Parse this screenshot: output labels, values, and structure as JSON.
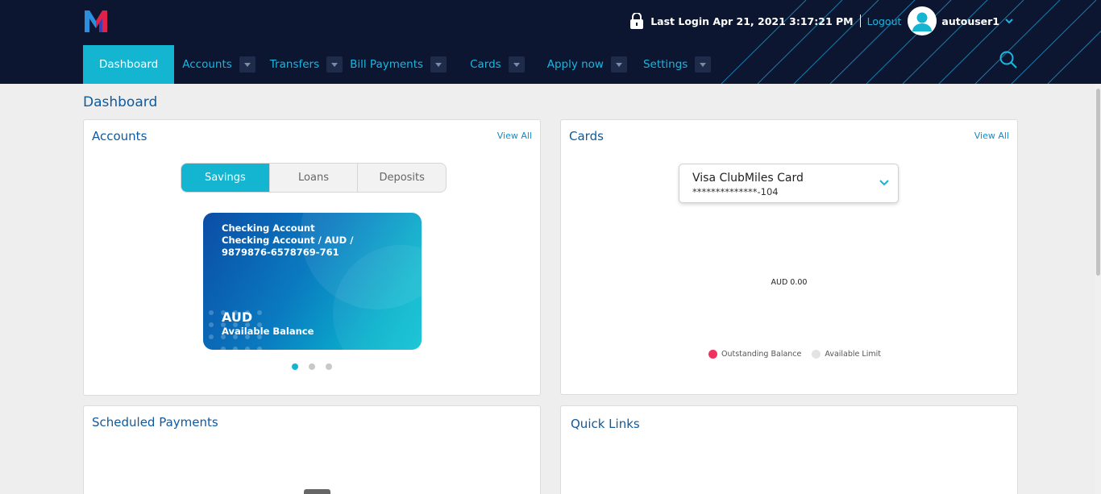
{
  "header": {
    "last_login": "Last Login Apr 21, 2021 3:17:21 PM",
    "logout": "Logout",
    "username": "autouser1"
  },
  "nav": [
    {
      "label": "Dashboard",
      "active": true
    },
    {
      "label": "Accounts"
    },
    {
      "label": "Transfers"
    },
    {
      "label": "Bill Payments"
    },
    {
      "label": "Cards"
    },
    {
      "label": "Apply now"
    },
    {
      "label": "Settings"
    }
  ],
  "page": {
    "title": "Dashboard"
  },
  "accounts": {
    "title": "Accounts",
    "view_all": "View All",
    "tabs": [
      "Savings",
      "Loans",
      "Deposits"
    ],
    "card": {
      "name": "Checking Account",
      "detail": "Checking Account / AUD / 9879876-6578769-761",
      "currency": "AUD",
      "balance_label": "Available Balance"
    }
  },
  "cards": {
    "title": "Cards",
    "view_all": "View All",
    "selected_card": "Visa ClubMiles Card",
    "card_number": "**************-104",
    "amount": "AUD 0.00",
    "legend": [
      "Outstanding Balance",
      "Available Limit"
    ],
    "colors": {
      "outstanding": "#f0305e",
      "available": "#e3e3e3"
    }
  },
  "scheduled_payments": {
    "title": "Scheduled Payments"
  },
  "quick_links": {
    "title": "Quick Links"
  },
  "colors": {
    "header_bg": "#0d1631",
    "accent": "#14b5d0",
    "title_blue": "#0d5a9e"
  }
}
